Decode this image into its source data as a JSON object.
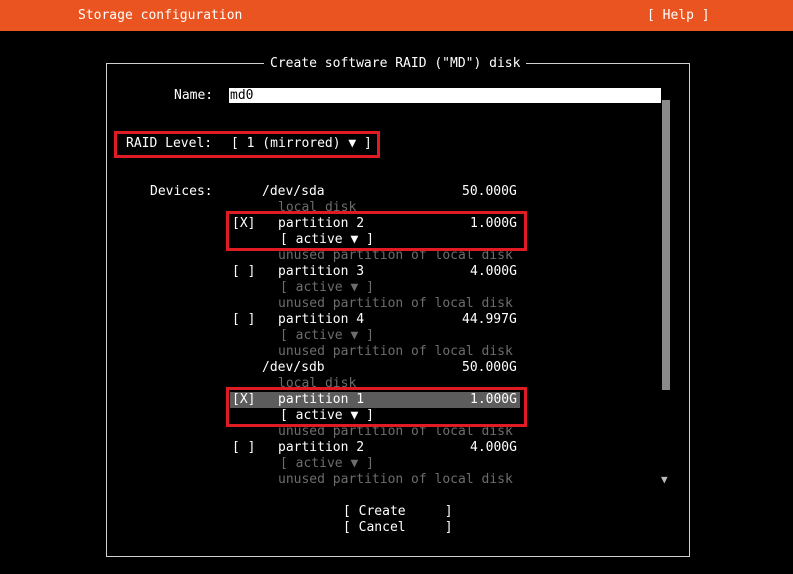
{
  "header": {
    "title": "Storage configuration",
    "help": "[ Help ]",
    "color": "#e95420"
  },
  "dialog": {
    "title": "Create software RAID (\"MD\") disk",
    "name_label": "Name:",
    "name_value": "md0",
    "raid_label": "RAID Level:",
    "raid_value": "[ 1 (mirrored) ▼ ]",
    "devices_label": "Devices:",
    "disks": [
      {
        "name": "/dev/sda",
        "size": "50.000G",
        "desc": "local disk",
        "partitions": [
          {
            "checkbox": "[X]",
            "name": "partition 2",
            "size": "1.000G",
            "status": "[ active ▼ ]",
            "desc": "unused partition of local disk"
          },
          {
            "checkbox": "[ ]",
            "name": "partition 3",
            "size": "4.000G",
            "status": "[ active ▼ ]",
            "desc": "unused partition of local disk"
          },
          {
            "checkbox": "[ ]",
            "name": "partition 4",
            "size": "44.997G",
            "status": "[ active ▼ ]",
            "desc": "unused partition of local disk"
          }
        ]
      },
      {
        "name": "/dev/sdb",
        "size": "50.000G",
        "desc": "local disk",
        "partitions": [
          {
            "checkbox": "[X]",
            "name": "partition 1",
            "size": "1.000G",
            "status": "[ active ▼ ]",
            "desc": "unused partition of local disk"
          },
          {
            "checkbox": "[ ]",
            "name": "partition 2",
            "size": "4.000G",
            "status": "[ active ▼ ]",
            "desc": "unused partition of local disk"
          }
        ]
      }
    ],
    "scroll_up": "▲",
    "scroll_down": "▼",
    "buttons": {
      "create": "[ Create     ]",
      "cancel": "[ Cancel     ]"
    }
  },
  "colors": {
    "highlight": "#e01b24",
    "dim_text": "#6c6c6c",
    "selected_row": "#5c5c5c"
  }
}
